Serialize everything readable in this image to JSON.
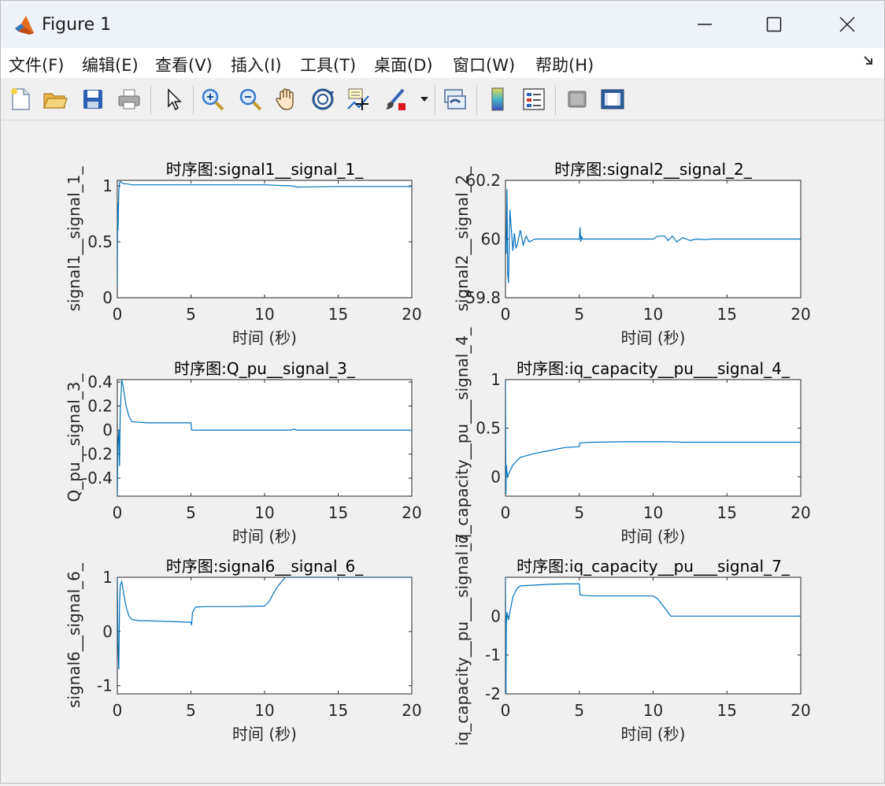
{
  "window": {
    "title": "Figure 1",
    "controls": {
      "minimize": "—",
      "maximize": "☐",
      "close": "✕"
    }
  },
  "menubar": {
    "items": [
      "文件(F)",
      "编辑(E)",
      "查看(V)",
      "插入(I)",
      "工具(T)",
      "桌面(D)",
      "窗口(W)",
      "帮助(H)"
    ],
    "extra_icon": "dock-arrow-icon"
  },
  "toolbar": {
    "buttons": [
      "new-figure-icon",
      "open-file-icon",
      "save-icon",
      "print-icon",
      "edit-plot-arrow-icon",
      "zoom-in-icon",
      "zoom-out-icon",
      "pan-hand-icon",
      "rotate-3d-icon",
      "data-cursor-icon",
      "brush-icon",
      "brush-dropdown-icon",
      "link-plot-icon",
      "insert-colorbar-icon",
      "insert-legend-icon",
      "hide-plot-tools-icon",
      "show-plot-tools-icon"
    ]
  },
  "colors": {
    "line": "#0072bd",
    "axes_bg": "#ffffff",
    "figure_bg": "#f0f0f0",
    "text": "#262626"
  },
  "chart_data": [
    {
      "type": "line",
      "title": "时序图:signal1__signal_1_",
      "xlabel": "时间 (秒)",
      "ylabel": "signal1__signal_1_",
      "xlim": [
        0,
        20
      ],
      "ylim": [
        0,
        1.05
      ],
      "xticks": [
        0,
        5,
        10,
        15,
        20
      ],
      "yticks": [
        0,
        0.5,
        1
      ],
      "ytick_labels": [
        "0",
        "0.5",
        "1"
      ],
      "x": [
        0,
        0.02,
        0.05,
        0.1,
        0.15,
        0.2,
        0.3,
        0.4,
        0.6,
        1,
        2,
        5,
        10,
        11.9,
        12.2,
        15,
        20
      ],
      "y": [
        0.1,
        0.85,
        0.6,
        0.95,
        1.03,
        1.04,
        1.03,
        1.02,
        1.02,
        1.01,
        1.01,
        1.01,
        1.01,
        1.0,
        0.99,
        0.995,
        0.995
      ]
    },
    {
      "type": "line",
      "title": "时序图:signal2__signal_2_",
      "xlabel": "时间 (秒)",
      "ylabel": "signal2__signal_2_",
      "xlim": [
        0,
        20
      ],
      "ylim": [
        59.8,
        60.2
      ],
      "xticks": [
        0,
        5,
        10,
        15,
        20
      ],
      "yticks": [
        59.8,
        60,
        60.2
      ],
      "ytick_labels": [
        "59.8",
        "60",
        "60.2"
      ],
      "x": [
        0,
        0.05,
        0.1,
        0.15,
        0.2,
        0.3,
        0.4,
        0.5,
        0.6,
        0.7,
        0.8,
        1,
        1.2,
        1.4,
        1.6,
        2,
        3,
        4,
        5,
        5.05,
        5.1,
        5.15,
        5.2,
        6,
        8,
        10,
        10.3,
        10.8,
        11,
        11.3,
        11.6,
        12,
        12.5,
        13,
        13.5,
        14,
        15,
        20
      ],
      "y": [
        60,
        59.95,
        60.17,
        59.88,
        59.85,
        60.1,
        60.03,
        59.96,
        60.02,
        59.97,
        59.98,
        60.03,
        59.98,
        60.01,
        59.99,
        60.0,
        60.0,
        60.0,
        60.0,
        60.04,
        59.99,
        60.01,
        60.0,
        60.0,
        60.0,
        60.0,
        60.01,
        60.01,
        59.995,
        60.01,
        59.99,
        60.005,
        59.995,
        60.0,
        59.998,
        60.0,
        60.0,
        60.0
      ]
    },
    {
      "type": "line",
      "title": "时序图:Q_pu__signal_3_",
      "xlabel": "时间 (秒)",
      "ylabel": "Q_pu__signal_3_",
      "xlim": [
        0,
        20
      ],
      "ylim": [
        -0.55,
        0.42
      ],
      "xticks": [
        0,
        5,
        10,
        15,
        20
      ],
      "yticks": [
        -0.4,
        -0.2,
        0,
        0.2,
        0.4
      ],
      "ytick_labels": [
        "-0.4",
        "-0.2",
        "0",
        "0.2",
        "0.4"
      ],
      "x": [
        0,
        0.05,
        0.1,
        0.15,
        0.2,
        0.3,
        0.4,
        0.5,
        0.6,
        0.8,
        1,
        1.5,
        2,
        3,
        4,
        5,
        5.05,
        6,
        10,
        11.8,
        12.0,
        12.2,
        15,
        20
      ],
      "y": [
        -0.55,
        -0.1,
        0.0,
        -0.3,
        0.15,
        0.42,
        0.36,
        0.28,
        0.2,
        0.11,
        0.07,
        0.065,
        0.06,
        0.06,
        0.06,
        0.06,
        0.0,
        0.0,
        0.0,
        0.0,
        0.008,
        0.0,
        0.0,
        0.0
      ]
    },
    {
      "type": "line",
      "title": "时序图:iq_capacity__pu___signal_4_",
      "xlabel": "时间 (秒)",
      "ylabel": "iq_capacity__pu___signal_4_",
      "xlim": [
        0,
        20
      ],
      "ylim": [
        -0.2,
        1
      ],
      "xticks": [
        0,
        5,
        10,
        15,
        20
      ],
      "yticks": [
        0,
        0.5,
        1
      ],
      "ytick_labels": [
        "0",
        "0.5",
        "1"
      ],
      "x": [
        0,
        0.03,
        0.06,
        0.1,
        0.15,
        0.2,
        0.3,
        0.5,
        0.8,
        1,
        1.5,
        2,
        3,
        4,
        5,
        5.05,
        6,
        8,
        10,
        11,
        12,
        15,
        20
      ],
      "y": [
        1.0,
        -0.18,
        0.12,
        0.05,
        0.0,
        0.02,
        0.06,
        0.12,
        0.17,
        0.2,
        0.22,
        0.24,
        0.27,
        0.3,
        0.31,
        0.35,
        0.355,
        0.36,
        0.36,
        0.36,
        0.355,
        0.355,
        0.355
      ]
    },
    {
      "type": "line",
      "title": "时序图:signal6__signal_6_",
      "xlabel": "时间 (秒)",
      "ylabel": "signal6__signal_6_",
      "xlim": [
        0,
        20
      ],
      "ylim": [
        -1.15,
        1.0
      ],
      "xticks": [
        0,
        5,
        10,
        15,
        20
      ],
      "yticks": [
        -1,
        0,
        1
      ],
      "ytick_labels": [
        "-1",
        "0",
        "1"
      ],
      "x": [
        0,
        0.05,
        0.1,
        0.15,
        0.2,
        0.3,
        0.4,
        0.6,
        0.8,
        1,
        1.5,
        2,
        3,
        4,
        5,
        5.05,
        5.1,
        5.3,
        6,
        8,
        10,
        10.3,
        10.8,
        11.4,
        12,
        15,
        20
      ],
      "y": [
        1.0,
        -0.25,
        -0.7,
        0.5,
        0.85,
        0.92,
        0.75,
        0.45,
        0.28,
        0.22,
        0.2,
        0.2,
        0.19,
        0.18,
        0.17,
        0.12,
        0.35,
        0.45,
        0.46,
        0.46,
        0.47,
        0.55,
        0.8,
        1.0,
        1.0,
        1.0,
        1.0
      ]
    },
    {
      "type": "line",
      "title": "时序图:iq_capacity__pu___signal_7_",
      "xlabel": "时间 (秒)",
      "ylabel": "iq_capacity__pu___signal_7_",
      "xlim": [
        0,
        20
      ],
      "ylim": [
        -2,
        1
      ],
      "xticks": [
        0,
        5,
        10,
        15,
        20
      ],
      "yticks": [
        -2,
        -1,
        0
      ],
      "ytick_labels": [
        "-2",
        "-1",
        "0"
      ],
      "x": [
        0,
        0.03,
        0.06,
        0.1,
        0.2,
        0.3,
        0.5,
        0.8,
        1,
        2,
        3,
        4,
        5,
        5.05,
        5.3,
        6,
        8,
        10,
        10.3,
        10.8,
        11.2,
        12,
        15,
        20
      ],
      "y": [
        1.0,
        -2.0,
        -0.2,
        0.1,
        -0.1,
        0.1,
        0.5,
        0.72,
        0.78,
        0.8,
        0.82,
        0.83,
        0.83,
        0.55,
        0.53,
        0.52,
        0.52,
        0.52,
        0.45,
        0.2,
        0.0,
        0.0,
        0.0,
        0.0
      ]
    }
  ]
}
